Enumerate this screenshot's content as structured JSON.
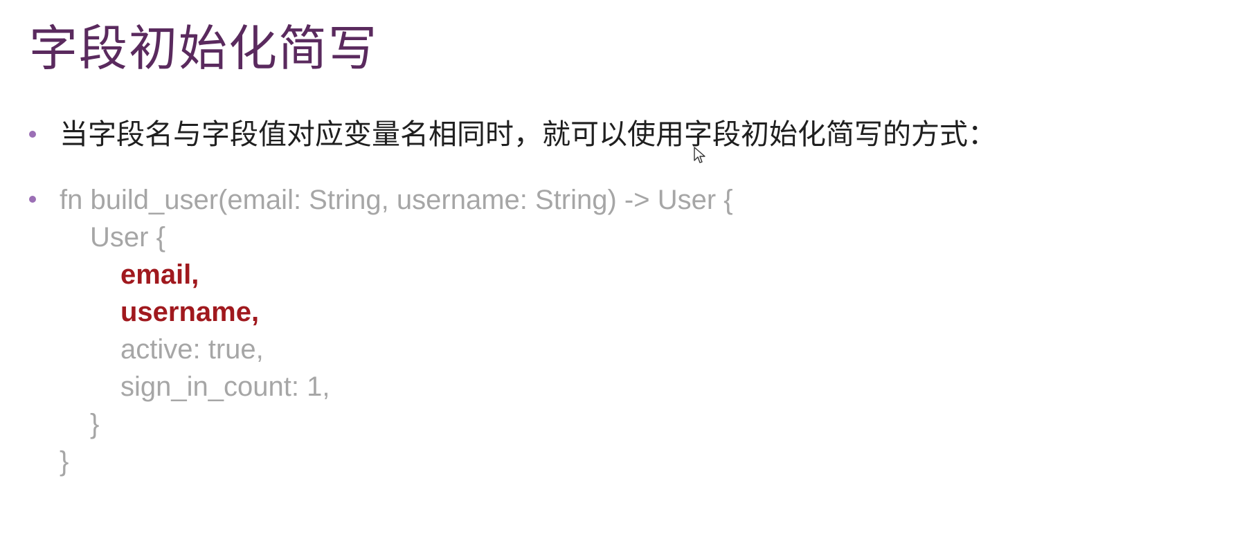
{
  "slide": {
    "title": "字段初始化简写",
    "bullets": [
      {
        "text": "当字段名与字段值对应变量名相同时，就可以使用字段初始化简写的方式："
      }
    ],
    "code": {
      "lines": [
        "fn build_user(email: String, username: String) -> User {",
        "User {",
        "email,",
        "username,",
        "active: true,",
        "sign_in_count: 1,",
        "}",
        "}"
      ]
    },
    "colors": {
      "title": "#5a2a5e",
      "bullet": "#9b6fb5",
      "body_text": "#1f1f1f",
      "code_text": "#a6a6a6",
      "highlight": "#a0191e"
    },
    "icons": {
      "cursor": "mouse-pointer-icon"
    }
  }
}
